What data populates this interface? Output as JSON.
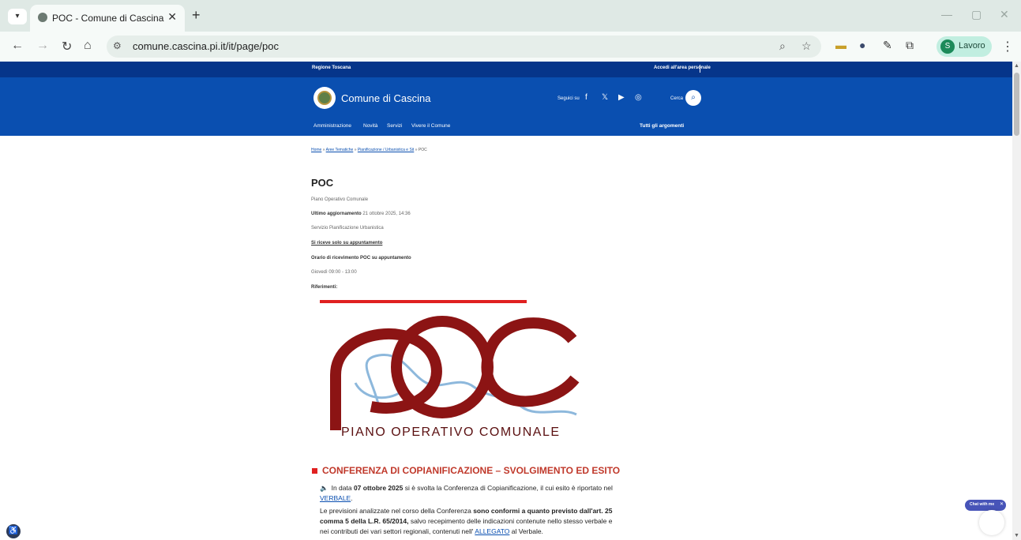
{
  "browser": {
    "tab_title": "POC - Comune di Cascina",
    "url": "comune.cascina.pi.it/it/page/poc",
    "profile_name": "Lavoro",
    "profile_initial": "S"
  },
  "site": {
    "region": "Regione Toscana",
    "login": "Accedi all'area personale",
    "name": "Comune di Cascina",
    "follow": "Seguici su",
    "search": "Cerca",
    "menu": [
      "Amministrazione",
      "Novità",
      "Servizi",
      "Vivere il Comune"
    ],
    "all_topics": "Tutti gli argomenti"
  },
  "breadcrumb": {
    "home": "Home",
    "areas": "Aree Tematiche",
    "planning": "Pianificazione / Urbanistica e Sit",
    "current": "POC",
    "sep": "»"
  },
  "page": {
    "title": "POC",
    "subtitle": "Piano Operativo Comunale",
    "updated_label": "Ultimo aggiornamento",
    "updated_value": "21 ottobre 2025, 14:36",
    "service": "Servizio Pianificazione Urbanistica",
    "appointment": "Si riceve solo su appuntamento",
    "hours_label": "Orario di ricevimento POC su appuntamento",
    "hours_value": "Giovedì 09:00 - 13:00",
    "references": "Riferimenti:",
    "logo_caption": "PIANO OPERATIVO COMUNALE"
  },
  "section": {
    "title": "CONFERENZA DI COPIANIFICAZIONE – SVOLGIMENTO ED ESITO",
    "p1_a": "In data ",
    "p1_b": "07 ottobre 2025",
    "p1_c": " si è svolta la Conferenza di Copianificazione, il cui esito è riportato nel",
    "p1_link": "VERBALE",
    "p2_a": "Le previsioni analizzate nel corso della Conferenza ",
    "p2_b": "sono conformi a quanto previsto dall'art. 25",
    "p2_c": "comma 5 della L.R. 65/2014,",
    "p2_d": " salvo recepimento delle indicazioni contenute nello stesso verbale e",
    "p2_e": "nei contributi dei vari settori regionali, contenuti nell' ",
    "p2_link": "ALLEGATO",
    "p2_f": " al Verbale."
  },
  "chat": {
    "label": "Chat with me"
  }
}
